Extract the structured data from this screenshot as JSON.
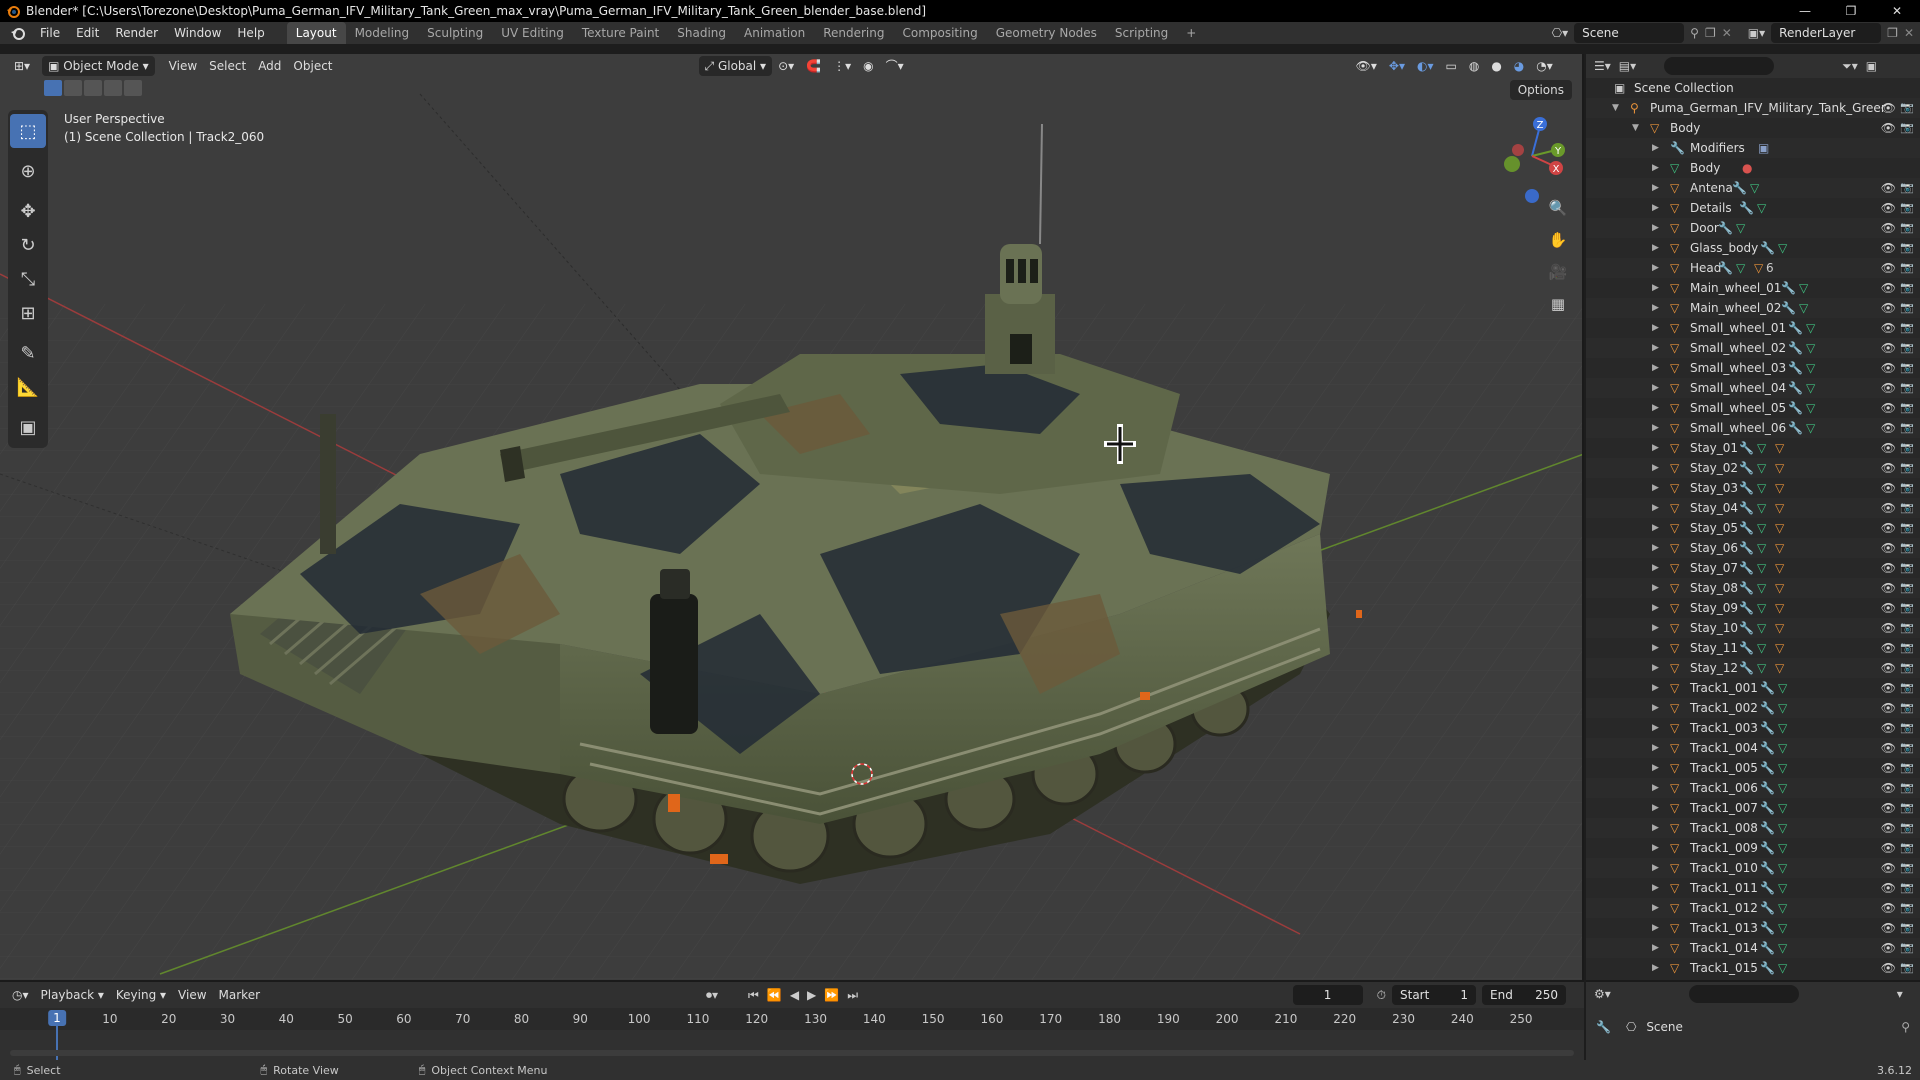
{
  "window": {
    "title": "Blender* [C:\\Users\\Torezone\\Desktop\\Puma_German_IFV_Military_Tank_Green_max_vray\\Puma_German_IFV_Military_Tank_Green_blender_base.blend]",
    "minimize": "—",
    "maximize": "❐",
    "close": "✕"
  },
  "menu": [
    "File",
    "Edit",
    "Render",
    "Window",
    "Help"
  ],
  "workspaces": [
    "Layout",
    "Modeling",
    "Sculpting",
    "UV Editing",
    "Texture Paint",
    "Shading",
    "Animation",
    "Rendering",
    "Compositing",
    "Geometry Nodes",
    "Scripting"
  ],
  "active_workspace": "Layout",
  "scene_name": "Scene",
  "view_layer": "RenderLayer",
  "viewport": {
    "mode": "Object Mode",
    "menus": [
      "View",
      "Select",
      "Add",
      "Object"
    ],
    "orientation": "Global",
    "options": "Options",
    "info_line1": "User Perspective",
    "info_line2": "(1) Scene Collection | Track2_060",
    "gizmo": {
      "x": "X",
      "y": "Y",
      "z": "Z"
    }
  },
  "colors": {
    "accent": "#4772b3",
    "camo_green": "#5d6845",
    "camo_dark": "#1f2530",
    "camo_olive": "#8a8a5c",
    "camo_brown": "#6b5a3b",
    "grid_bg": "#3d3d3d",
    "axis_x": "#b33c3c",
    "axis_y": "#6a9a2a"
  },
  "timeline": {
    "menus": [
      "Playback",
      "Keying",
      "View",
      "Marker"
    ],
    "ticks": [
      10,
      20,
      30,
      40,
      50,
      60,
      70,
      80,
      90,
      100,
      110,
      120,
      130,
      140,
      150,
      160,
      170,
      180,
      190,
      200,
      210,
      220,
      230,
      240,
      250
    ],
    "current_frame": "1",
    "start_label": "Start",
    "start": "1",
    "end_label": "End",
    "end": "250"
  },
  "outliner": {
    "root": "Scene Collection",
    "collection": "Puma_German_IFV_Military_Tank_Greer",
    "body": "Body",
    "modifiers": "Modifiers",
    "items": [
      "Body",
      "Antena",
      "Details",
      "Door",
      "Glass_body",
      "Head",
      "Main_wheel_01",
      "Main_wheel_02",
      "Small_wheel_01",
      "Small_wheel_02",
      "Small_wheel_03",
      "Small_wheel_04",
      "Small_wheel_05",
      "Small_wheel_06",
      "Stay_01",
      "Stay_02",
      "Stay_03",
      "Stay_04",
      "Stay_05",
      "Stay_06",
      "Stay_07",
      "Stay_08",
      "Stay_09",
      "Stay_10",
      "Stay_11",
      "Stay_12",
      "Track1_001",
      "Track1_002",
      "Track1_003",
      "Track1_004",
      "Track1_005",
      "Track1_006",
      "Track1_007",
      "Track1_008",
      "Track1_009",
      "Track1_010",
      "Track1_011",
      "Track1_012",
      "Track1_013",
      "Track1_014",
      "Track1_015"
    ],
    "head_count": "6"
  },
  "properties": {
    "scene": "Scene"
  },
  "status": {
    "select": "Select",
    "rotate": "Rotate View",
    "context": "Object Context Menu",
    "version": "3.6.12"
  }
}
